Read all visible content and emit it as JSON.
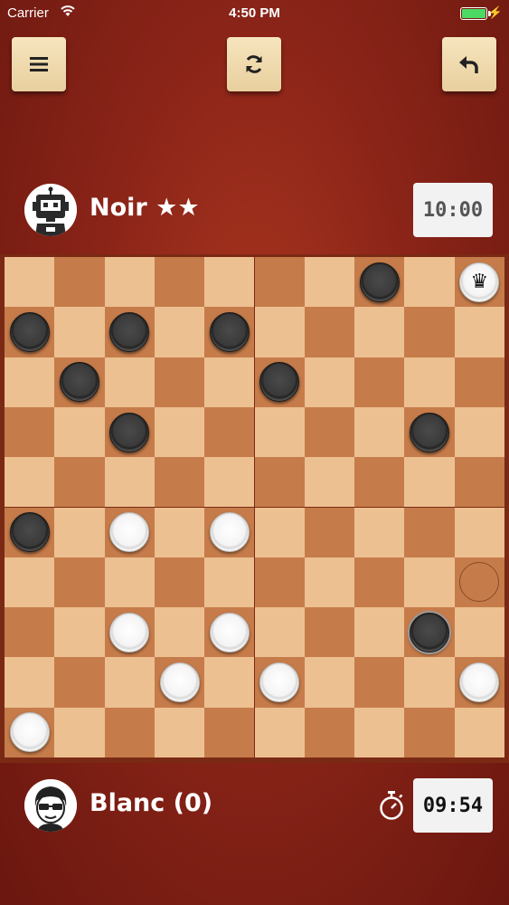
{
  "status_bar": {
    "carrier": "Carrier",
    "time": "4:50 PM"
  },
  "toolbar": {
    "menu_icon": "hamburger-icon",
    "restart_icon": "refresh-icon",
    "undo_icon": "undo-arrow-icon"
  },
  "opponent": {
    "name": "Noir ★★",
    "avatar": "robot-avatar",
    "timer": "10:00"
  },
  "player": {
    "name": "Blanc (0)",
    "avatar": "boy-with-glasses-avatar",
    "timer": "09:54",
    "timer_icon": "stopwatch-icon"
  },
  "board": {
    "size": 10,
    "pieces": [
      {
        "row": 0,
        "col": 7,
        "color": "black"
      },
      {
        "row": 0,
        "col": 9,
        "color": "white",
        "king": true
      },
      {
        "row": 1,
        "col": 0,
        "color": "black"
      },
      {
        "row": 1,
        "col": 2,
        "color": "black"
      },
      {
        "row": 1,
        "col": 4,
        "color": "black"
      },
      {
        "row": 2,
        "col": 1,
        "color": "black"
      },
      {
        "row": 2,
        "col": 5,
        "color": "black"
      },
      {
        "row": 3,
        "col": 2,
        "color": "black"
      },
      {
        "row": 3,
        "col": 8,
        "color": "black"
      },
      {
        "row": 5,
        "col": 0,
        "color": "black"
      },
      {
        "row": 5,
        "col": 2,
        "color": "white"
      },
      {
        "row": 5,
        "col": 4,
        "color": "white"
      },
      {
        "row": 7,
        "col": 2,
        "color": "white"
      },
      {
        "row": 7,
        "col": 4,
        "color": "white"
      },
      {
        "row": 7,
        "col": 8,
        "color": "black",
        "selected": true
      },
      {
        "row": 8,
        "col": 3,
        "color": "white"
      },
      {
        "row": 8,
        "col": 5,
        "color": "white"
      },
      {
        "row": 8,
        "col": 9,
        "color": "white"
      },
      {
        "row": 9,
        "col": 0,
        "color": "white"
      }
    ],
    "move_targets": [
      {
        "row": 6,
        "col": 9
      }
    ]
  }
}
